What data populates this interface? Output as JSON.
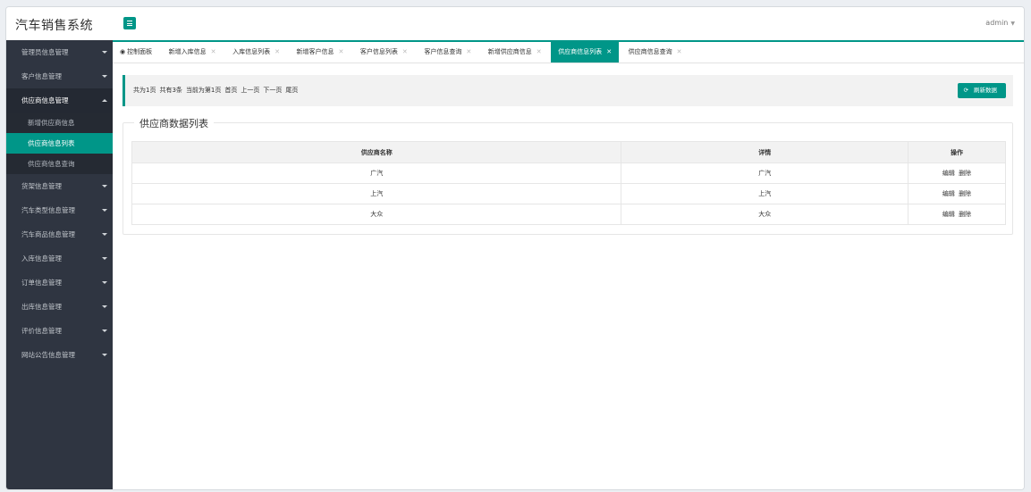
{
  "app": {
    "title": "汽车销售系统",
    "user": "admin"
  },
  "sidebar": {
    "groups": [
      {
        "label": "管理员信息管理",
        "open": false
      },
      {
        "label": "客户信息管理",
        "open": false
      },
      {
        "label": "供应商信息管理",
        "open": true,
        "children": [
          "新增供应商信息",
          "供应商信息列表",
          "供应商信息查询"
        ],
        "active_child": 1
      },
      {
        "label": "货架信息管理"
      },
      {
        "label": "汽车类型信息管理"
      },
      {
        "label": "汽车商品信息管理"
      },
      {
        "label": "入库信息管理"
      },
      {
        "label": "订单信息管理"
      },
      {
        "label": "出库信息管理"
      },
      {
        "label": "评价信息管理"
      },
      {
        "label": "网站公告信息管理"
      }
    ]
  },
  "tabs": [
    {
      "label": "控制面板",
      "icon": "dashboard-icon",
      "closable": false
    },
    {
      "label": "新增入库信息",
      "closable": true
    },
    {
      "label": "入库信息列表",
      "closable": true
    },
    {
      "label": "新增客户信息",
      "closable": true
    },
    {
      "label": "客户信息列表",
      "closable": true
    },
    {
      "label": "客户信息查询",
      "closable": true
    },
    {
      "label": "新增供应商信息",
      "closable": true
    },
    {
      "label": "供应商信息列表",
      "closable": true,
      "active": true
    },
    {
      "label": "供应商信息查询",
      "closable": true
    }
  ],
  "pager": {
    "total_pages": "共为1页",
    "total_items": "共有3条",
    "current": "当前为第1页",
    "first": "首页",
    "prev": "上一页",
    "next": "下一页",
    "last": "尾页",
    "refresh": "刷新数据"
  },
  "panel": {
    "legend": "供应商数据列表"
  },
  "table": {
    "headers": [
      "供应商名称",
      "详情",
      "操作"
    ],
    "rows": [
      {
        "name": "广汽",
        "detail": "广汽"
      },
      {
        "name": "上汽",
        "detail": "上汽"
      },
      {
        "name": "大众",
        "detail": "大众"
      }
    ],
    "edit_label": "编辑",
    "delete_label": "删除"
  },
  "colors": {
    "accent": "#009688",
    "sidebar": "#2f3541"
  }
}
